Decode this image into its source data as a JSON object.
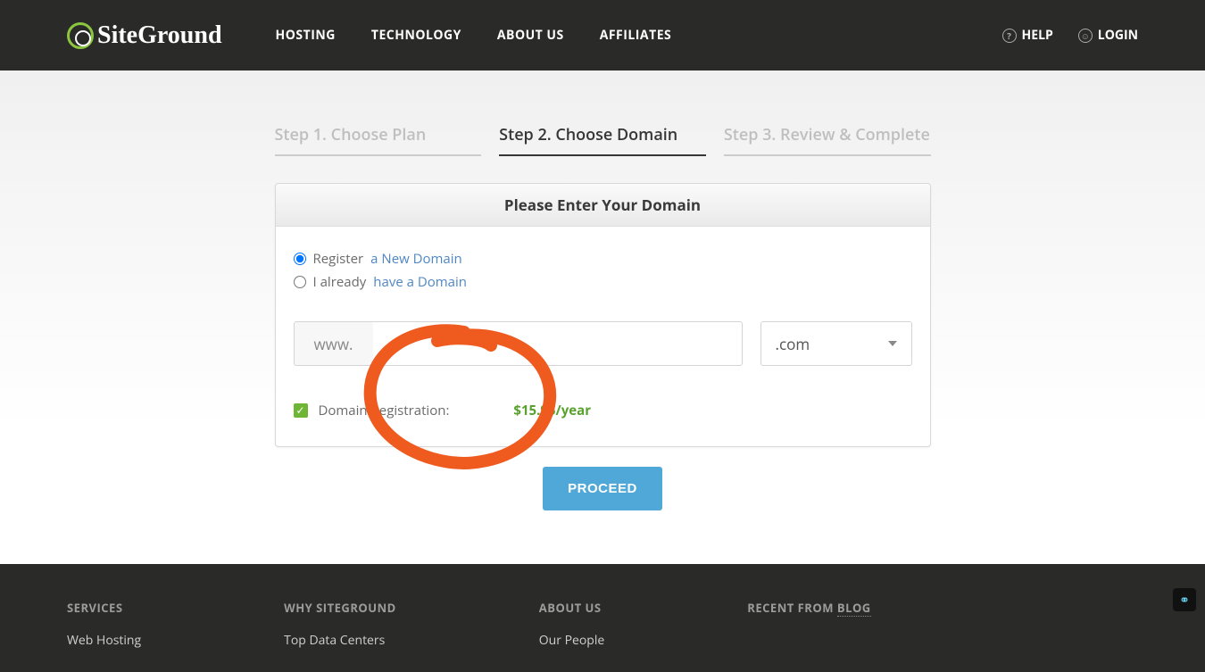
{
  "header": {
    "brand": "SiteGround",
    "nav": [
      "HOSTING",
      "TECHNOLOGY",
      "ABOUT US",
      "AFFILIATES"
    ],
    "help": "HELP",
    "login": "LOGIN"
  },
  "steps": {
    "s1": "Step 1. Choose Plan",
    "s2": "Step 2. Choose Domain",
    "s3": "Step 3. Review & Complete"
  },
  "card": {
    "title": "Please Enter Your Domain",
    "option1": {
      "lead": "Register",
      "rest": "a New Domain"
    },
    "option2": {
      "lead": "I already",
      "rest": "have a Domain"
    },
    "prefix": "www.",
    "domain_value": "",
    "tld": ".com",
    "reg_label": "Domain Registration:",
    "price": "$15.95/year",
    "proceed": "PROCEED"
  },
  "footer": {
    "col1": {
      "title": "SERVICES",
      "items": [
        "Web Hosting"
      ]
    },
    "col2": {
      "title": "WHY SITEGROUND",
      "items": [
        "Top Data Centers"
      ]
    },
    "col3": {
      "title": "ABOUT US",
      "items": [
        "Our People"
      ]
    },
    "col4": {
      "title_lead": "RECENT FROM ",
      "title_blog": "BLOG"
    }
  }
}
